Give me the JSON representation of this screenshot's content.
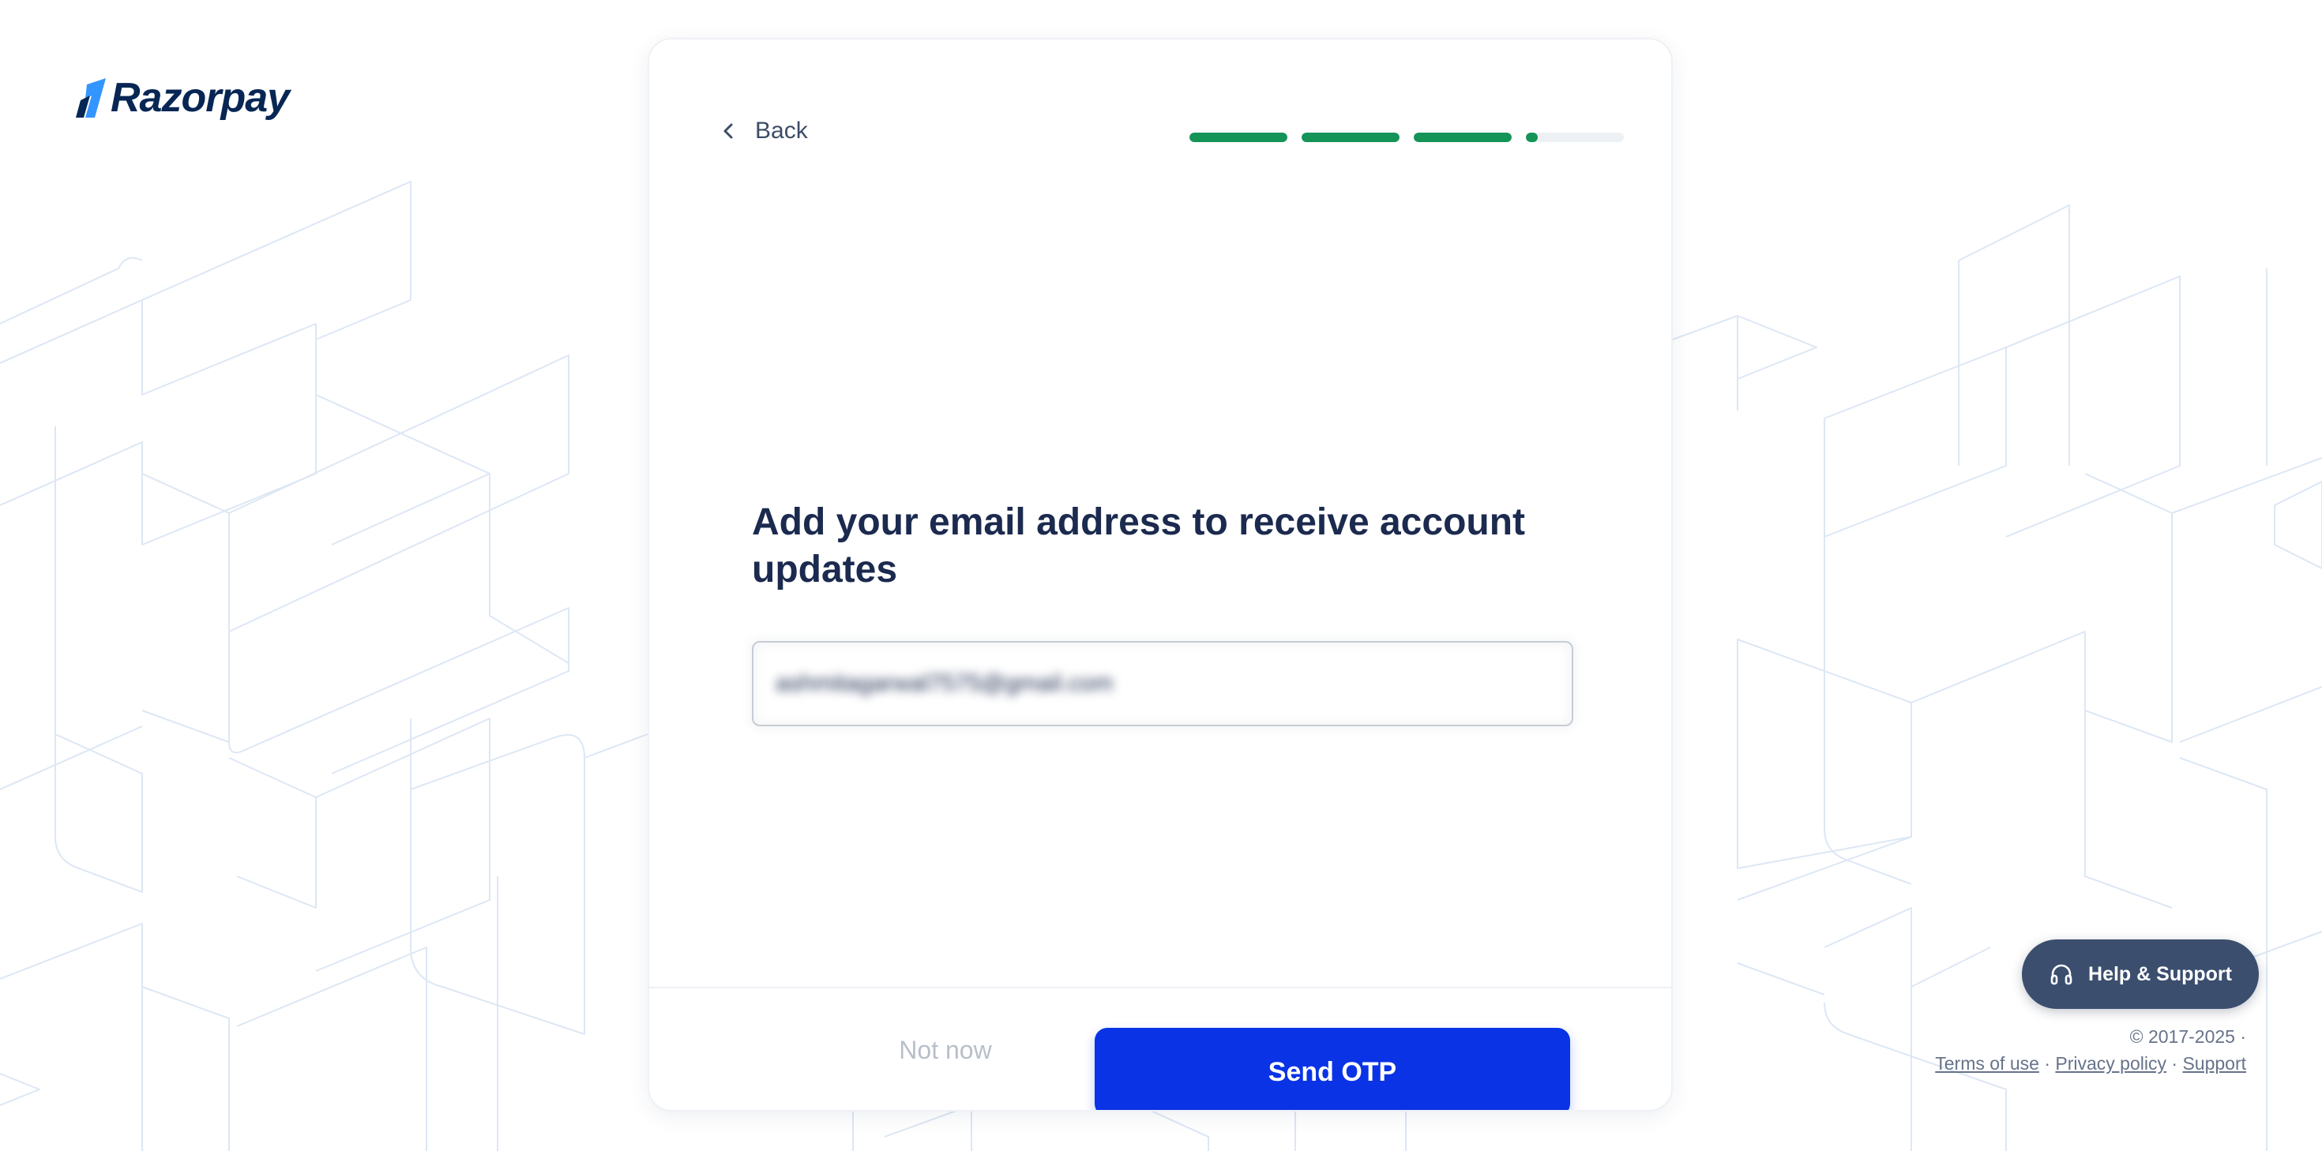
{
  "brand": {
    "name": "Razorpay",
    "text_color": "#072654",
    "accent_color": "#3395ff"
  },
  "header": {
    "back_label": "Back",
    "progress": {
      "steps": 4,
      "fills": [
        1,
        1,
        1,
        0.12
      ],
      "fill_color": "#159457",
      "track_color": "#eef1f4"
    }
  },
  "main": {
    "heading": "Add your email address to receive account updates",
    "email_value": "ashmitagarwal7575@gmail.com",
    "email_blurred": true
  },
  "footer": {
    "not_now_label": "Not now",
    "send_otp_label": "Send OTP",
    "send_otp_color": "#0a33e6"
  },
  "help": {
    "label": "Help & Support",
    "icon": "headphones-icon"
  },
  "page_footer": {
    "copyright": "© 2017-2025 ·",
    "terms": "Terms of use",
    "privacy": "Privacy policy",
    "support": "Support",
    "separator": "·"
  }
}
